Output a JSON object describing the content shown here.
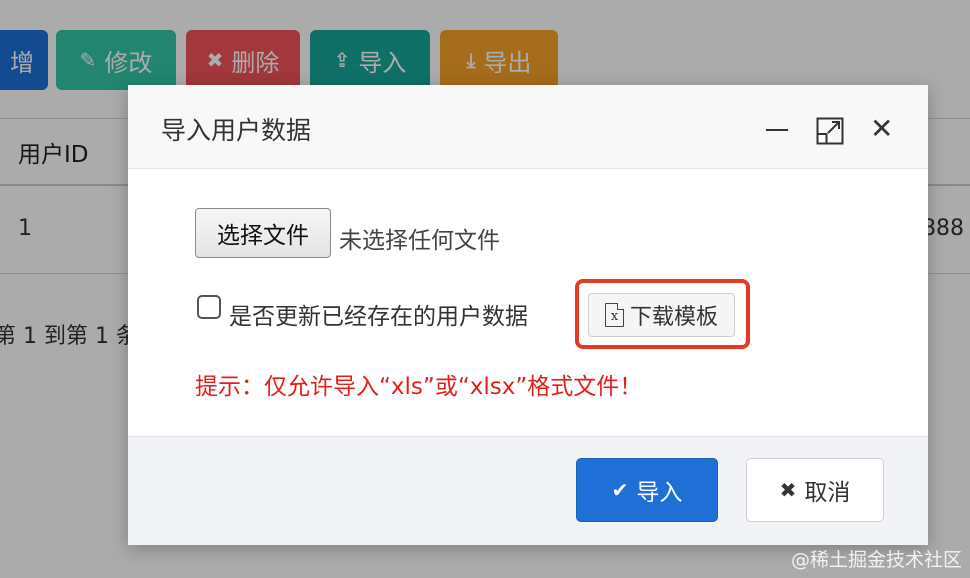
{
  "toolbar": {
    "add": {
      "label": "增",
      "color": "#1f6fd6"
    },
    "edit": {
      "label": "修改",
      "icon": "edit-icon",
      "color": "#33c6a8"
    },
    "delete": {
      "label": "删除",
      "icon": "close-icon",
      "color": "#f2535a"
    },
    "import": {
      "label": "导入",
      "icon": "upload-icon",
      "color": "#18a79b"
    },
    "export": {
      "label": "导出",
      "icon": "download-icon",
      "color": "#f7a22a"
    }
  },
  "table": {
    "header": {
      "user_id": "用户ID"
    },
    "rows": [
      {
        "user_id": "1",
        "trailing": "888"
      }
    ]
  },
  "pager": {
    "text": "第 1 到第 1 条"
  },
  "modal": {
    "title": "导入用户数据",
    "file_button": "选择文件",
    "file_status": "未选择任何文件",
    "checkbox_label": "是否更新已经存在的用户数据",
    "checkbox_checked": false,
    "download_button": "下载模板",
    "download_icon": "excel-file-icon",
    "tip": "提示：仅允许导入“xls”或“xlsx”格式文件！",
    "highlight_color": "#e63a25",
    "confirm_button": "导入",
    "cancel_button": "取消"
  },
  "watermark": "@稀土掘金技术社区"
}
